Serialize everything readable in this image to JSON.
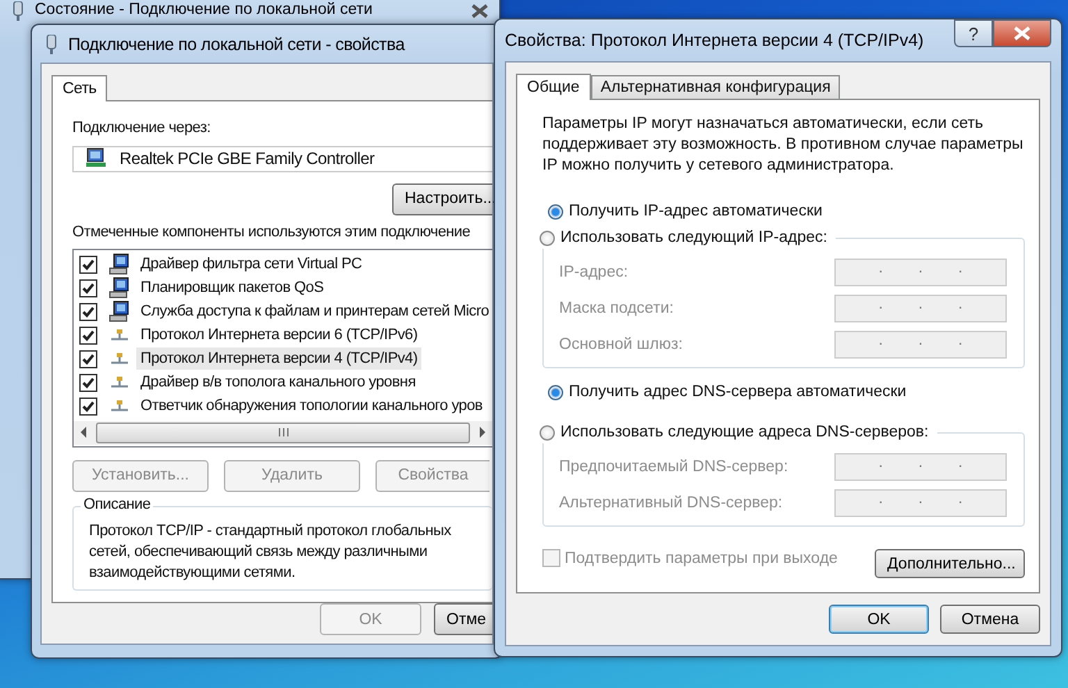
{
  "background_window": {
    "title": "Состояние - Подключение по локальной сети"
  },
  "properties_window": {
    "title": "Подключение по локальной сети - свойства",
    "tabs": [
      {
        "label": "Сеть",
        "selected": true
      }
    ],
    "connect_using_label": "Подключение через:",
    "adapter": "Realtek PCIe GBE Family Controller",
    "configure_button": "Настроить...",
    "components_label": "Отмеченные компоненты используются этим подключение",
    "components": [
      {
        "label": "Драйвер фильтра сети Virtual PC",
        "checked": true,
        "selected": false,
        "kind": "service"
      },
      {
        "label": "Планировщик пакетов QoS",
        "checked": true,
        "selected": false,
        "kind": "service"
      },
      {
        "label": "Служба доступа к файлам и принтерам сетей Micro",
        "checked": true,
        "selected": false,
        "kind": "service"
      },
      {
        "label": "Протокол Интернета версии 6 (TCP/IPv6)",
        "checked": true,
        "selected": false,
        "kind": "protocol"
      },
      {
        "label": "Протокол Интернета версии 4 (TCP/IPv4)",
        "checked": true,
        "selected": true,
        "kind": "protocol"
      },
      {
        "label": "Драйвер в/в тополога канального уровня",
        "checked": true,
        "selected": false,
        "kind": "protocol"
      },
      {
        "label": "Ответчик обнаружения топологии канального уров",
        "checked": true,
        "selected": false,
        "kind": "protocol"
      }
    ],
    "buttons": [
      {
        "label": "Установить...",
        "disabled": true
      },
      {
        "label": "Удалить",
        "disabled": true
      },
      {
        "label": "Свойства",
        "disabled": true
      }
    ],
    "description": {
      "title": "Описание",
      "text": "Протокол TCP/IP - стандартный протокол глобальных сетей, обеспечивающий связь между различными взаимодействующими сетями."
    },
    "dialog_buttons": [
      {
        "label": "OK",
        "disabled": true
      },
      {
        "label": "Отме",
        "disabled": false
      }
    ]
  },
  "ipv4_window": {
    "title": "Свойства: Протокол Интернета версии 4 (TCP/IPv4)",
    "help_button": "?",
    "tabs": [
      {
        "label": "Общие",
        "selected": true
      },
      {
        "label": "Альтернативная конфигурация",
        "selected": false
      }
    ],
    "intro": "Параметры IP могут назначаться автоматически, если сеть поддерживает эту возможность. В противном случае параметры IP можно получить у сетевого администратора.",
    "ip_auto": {
      "label": "Получить IP-адрес автоматически",
      "selected": true
    },
    "ip_manual": {
      "label": "Использовать следующий IP-адрес:",
      "selected": false
    },
    "ip_fields": [
      {
        "label": "IP-адрес:",
        "disabled": true,
        "dots": [
          ".",
          ".",
          "."
        ]
      },
      {
        "label": "Маска подсети:",
        "disabled": true,
        "dots": [
          ".",
          ".",
          "."
        ]
      },
      {
        "label": "Основной шлюз:",
        "disabled": true,
        "dots": [
          ".",
          ".",
          "."
        ]
      }
    ],
    "dns_auto": {
      "label": "Получить адрес DNS-сервера автоматически",
      "selected": true
    },
    "dns_manual": {
      "label": "Использовать следующие адреса DNS-серверов:",
      "selected": false
    },
    "dns_fields": [
      {
        "label": "Предпочитаемый DNS-сервер:",
        "disabled": true,
        "dots": [
          ".",
          ".",
          "."
        ]
      },
      {
        "label": "Альтернативный DNS-сервер:",
        "disabled": true,
        "dots": [
          ".",
          ".",
          "."
        ]
      }
    ],
    "validate": {
      "label": "Подтвердить параметры при выходе",
      "checked": false,
      "disabled": true
    },
    "advanced_button": "Дополнительно...",
    "dialog_buttons": [
      {
        "label": "OK",
        "default": true
      },
      {
        "label": "Отмена",
        "default": false
      }
    ]
  }
}
